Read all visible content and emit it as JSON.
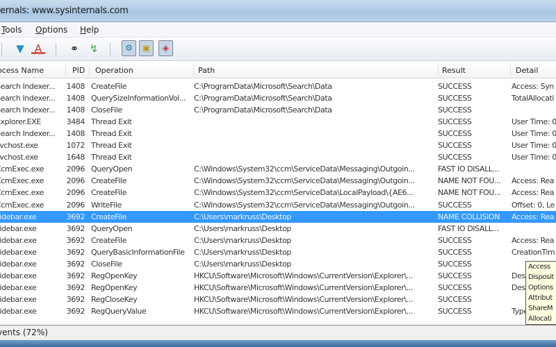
{
  "window": {
    "title": "ernals: www.sysinternals.com"
  },
  "menu": [
    "Tools",
    "Options",
    "Help"
  ],
  "toolbar": {
    "icons": [
      "filter-icon",
      "highlight-icon",
      "find-icon",
      "jump-icon",
      "registry-toggle-icon",
      "filesystem-toggle-icon",
      "process-toggle-icon"
    ]
  },
  "columns": [
    "ocess Name",
    "PID",
    "Operation",
    "Path",
    "Result",
    "Detail"
  ],
  "rows": [
    {
      "process": "Search Indexer...",
      "pid": "1408",
      "operation": "CreateFile",
      "path": "C:\\ProgramData\\Microsoft\\Search\\Data",
      "result": "SUCCESS",
      "detail": "Access: Syn"
    },
    {
      "process": "Search Indexer...",
      "pid": "1408",
      "operation": "QuerySizeInformationVol...",
      "path": "C:\\ProgramData\\Microsoft\\Search\\Data",
      "result": "SUCCESS",
      "detail": "TotalAllocati"
    },
    {
      "process": "Search Indexer...",
      "pid": "1408",
      "operation": "CloseFile",
      "path": "C:\\ProgramData\\Microsoft\\Search\\Data",
      "result": "SUCCESS",
      "detail": ""
    },
    {
      "process": "Explorer.EXE",
      "pid": "3484",
      "operation": "Thread Exit",
      "path": "",
      "result": "SUCCESS",
      "detail": "User Time: 0"
    },
    {
      "process": "Search Indexer...",
      "pid": "1408",
      "operation": "Thread Exit",
      "path": "",
      "result": "SUCCESS",
      "detail": "User Time: 0"
    },
    {
      "process": "svchost.exe",
      "pid": "1072",
      "operation": "Thread Exit",
      "path": "",
      "result": "SUCCESS",
      "detail": "User Time: 0"
    },
    {
      "process": "svchost.exe",
      "pid": "1648",
      "operation": "Thread Exit",
      "path": "",
      "result": "SUCCESS",
      "detail": "User Time: 0"
    },
    {
      "process": "CcmExec.exe",
      "pid": "2096",
      "operation": "QueryOpen",
      "path": "C:\\Windows\\System32\\ccm\\ServiceData\\Messaging\\Outgoin...",
      "result": "FAST IO DISALL...",
      "detail": ""
    },
    {
      "process": "CcmExec.exe",
      "pid": "2096",
      "operation": "CreateFile",
      "path": "C:\\Windows\\System32\\ccm\\ServiceData\\Messaging\\Outgoin...",
      "result": "NAME NOT FOU...",
      "detail": "Access: Rea"
    },
    {
      "process": "CcmExec.exe",
      "pid": "2096",
      "operation": "CreateFile",
      "path": "C:\\Windows\\System32\\ccm\\ServiceData\\LocalPayload\\{AE6...",
      "result": "NAME NOT FOU...",
      "detail": "Access: Rea"
    },
    {
      "process": "CcmExec.exe",
      "pid": "2096",
      "operation": "WriteFile",
      "path": "C:\\Windows\\System32\\ccm\\ServiceData\\Messaging\\Outgoin...",
      "result": "SUCCESS",
      "detail": "Offset: 0, Le"
    },
    {
      "process": "sidebar.exe",
      "pid": "3692",
      "operation": "CreateFile",
      "path": "C:\\Users\\markruss\\Desktop",
      "result": "NAME COLLISION",
      "detail": "Access: Rea",
      "selected": true
    },
    {
      "process": "sidebar.exe",
      "pid": "3692",
      "operation": "QueryOpen",
      "path": "C:\\Users\\markruss\\Desktop",
      "result": "FAST IO DISALL...",
      "detail": ""
    },
    {
      "process": "sidebar.exe",
      "pid": "3692",
      "operation": "CreateFile",
      "path": "C:\\Users\\markruss\\Desktop",
      "result": "SUCCESS",
      "detail": "Access: Rea"
    },
    {
      "process": "sidebar.exe",
      "pid": "3692",
      "operation": "QueryBasicInformationFile",
      "path": "C:\\Users\\markruss\\Desktop",
      "result": "SUCCESS",
      "detail": "CreationTim"
    },
    {
      "process": "sidebar.exe",
      "pid": "3692",
      "operation": "CloseFile",
      "path": "C:\\Users\\markruss\\Desktop",
      "result": "SUCCESS",
      "detail": ""
    },
    {
      "process": "sidebar.exe",
      "pid": "3692",
      "operation": "RegOpenKey",
      "path": "HKCU\\Software\\Microsoft\\Windows\\CurrentVersion\\Explorer\\...",
      "result": "SUCCESS",
      "detail": "Desi"
    },
    {
      "process": "sidebar.exe",
      "pid": "3692",
      "operation": "RegOpenKey",
      "path": "HKCU\\Software\\Microsoft\\Windows\\CurrentVersion\\Explorer\\...",
      "result": "SUCCESS",
      "detail": "Desi"
    },
    {
      "process": "sidebar.exe",
      "pid": "3692",
      "operation": "RegCloseKey",
      "path": "HKCU\\Software\\Microsoft\\Windows\\CurrentVersion\\Explorer\\...",
      "result": "SUCCESS",
      "detail": ""
    },
    {
      "process": "sidebar.exe",
      "pid": "3692",
      "operation": "RegQueryValue",
      "path": "HKCU\\Software\\Microsoft\\Windows\\CurrentVersion\\Explorer\\...",
      "result": "SUCCESS",
      "detail": "Type"
    }
  ],
  "tooltip": [
    "Access",
    "Disposit",
    "Options",
    "Attribut",
    "ShareM",
    "Allocati"
  ],
  "status": {
    "text": "vents (72%)"
  },
  "colors": {
    "selection": "#3399ff",
    "tooltip": "#ffffe1"
  }
}
